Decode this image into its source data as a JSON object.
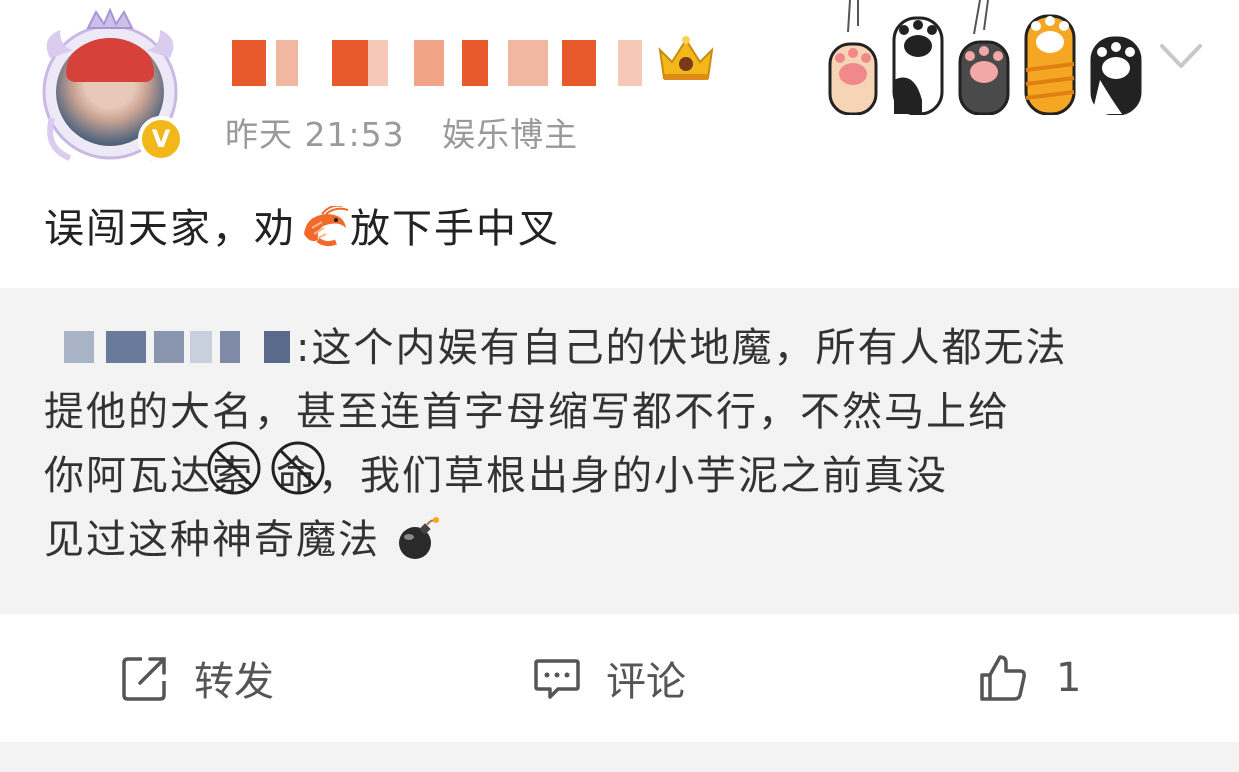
{
  "post": {
    "timestamp": "昨天 21:53",
    "author_tag": "娱乐博主",
    "text_before": "误闯天家，劝",
    "text_after": "放下手中叉"
  },
  "repost": {
    "line1": ":这个内娱有自己的伏地魔，所有人都无法",
    "line2": "提他的大名，甚至连首字母缩写都不行，不然马上给",
    "line3_before": "你阿瓦达",
    "circled_1": "索",
    "circled_2": "命",
    "line3_after": "，我们草根出身的小芋泥之前真没",
    "line4": "见过这种神奇魔法"
  },
  "actions": {
    "share_label": "转发",
    "comment_label": "评论",
    "like_count": "1"
  },
  "icons": {
    "verify": "v-badge-icon",
    "crown": "crown-icon",
    "shrimp": "shrimp-emoji",
    "bomb": "bomb-emoji",
    "share": "share-icon",
    "comment": "comment-icon",
    "like": "thumbs-up-icon",
    "chevron": "chevron-down-icon",
    "verify_letter": "V"
  },
  "colors": {
    "verify_badge": "#f2b81a",
    "repost_bg": "#f3f3f3",
    "meta_text": "#9a9a9a",
    "blur_orange": "#e8592b",
    "blur_blue": "#6a7a9a"
  }
}
